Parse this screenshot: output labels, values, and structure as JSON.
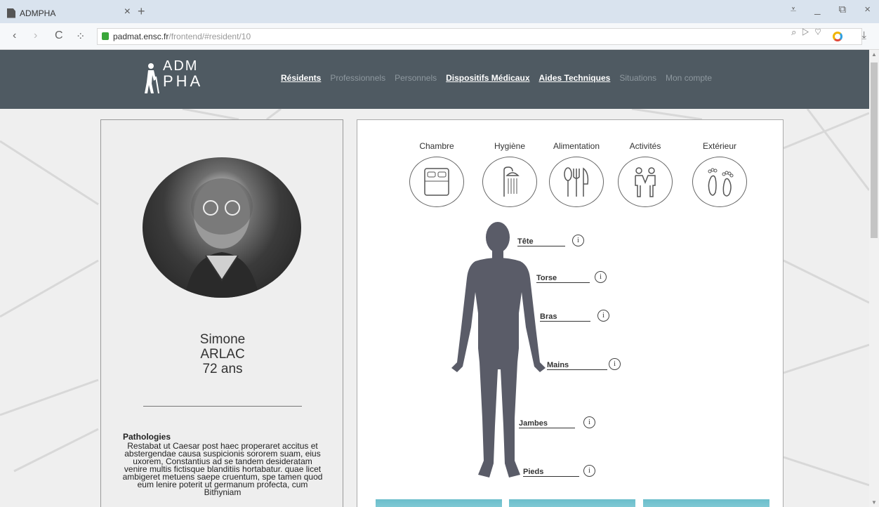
{
  "browser": {
    "tab_title": "ADMPHA",
    "tab_close": "×",
    "new_tab": "+",
    "url_host": "padmat.ensc.fr",
    "url_path": "/frontend/#resident/10",
    "nav_back": "‹",
    "nav_forward": "›",
    "reload": "C",
    "apps": "⁘",
    "addr_icons": "⌕ ▷ ♡",
    "download": "⤓",
    "window_controls": [
      "⩡",
      "_",
      "⧉",
      "×"
    ]
  },
  "site": {
    "logo_top": "ADM",
    "logo_bottom": "PHA",
    "nav": [
      {
        "label": "Résidents",
        "active": true
      },
      {
        "label": "Professionnels",
        "active": false
      },
      {
        "label": "Personnels",
        "active": false
      },
      {
        "label": "Dispositifs Médicaux",
        "active": true
      },
      {
        "label": "Aides Techniques",
        "active": true
      },
      {
        "label": "Situations",
        "active": false
      },
      {
        "label": "Mon compte",
        "active": false
      }
    ]
  },
  "resident": {
    "first_name": "Simone",
    "last_name": "ARLAC",
    "age": "72 ans",
    "pathologies_title": "Pathologies",
    "pathologies_text": "Restabat ut Caesar post haec properaret accitus et abstergendae causa suspicionis sororem suam, eius uxorem, Constantius ad se tandem desideratam venire multis fictisque blanditiis hortabatur. quae licet ambigeret metuens saepe cruentum, spe tamen quod eum lenire poterit ut germanum profecta, cum Bithyniam"
  },
  "categories": [
    {
      "label": "Chambre",
      "icon": "bed-icon"
    },
    {
      "label": "Hygiène",
      "icon": "shower-icon"
    },
    {
      "label": "Alimentation",
      "icon": "cutlery-icon"
    },
    {
      "label": "Activités",
      "icon": "people-icon"
    },
    {
      "label": "Extérieur",
      "icon": "footprints-icon"
    }
  ],
  "body_parts": [
    {
      "label": "Tête",
      "info": "i"
    },
    {
      "label": "Torse",
      "info": "i"
    },
    {
      "label": "Bras",
      "info": "i"
    },
    {
      "label": "Mains",
      "info": "i"
    },
    {
      "label": "Jambes",
      "info": "i"
    },
    {
      "label": "Pieds",
      "info": "i"
    }
  ],
  "colors": {
    "header": "#4f5a62",
    "silhouette": "#5a5c68",
    "tile": "#6bbecb"
  }
}
